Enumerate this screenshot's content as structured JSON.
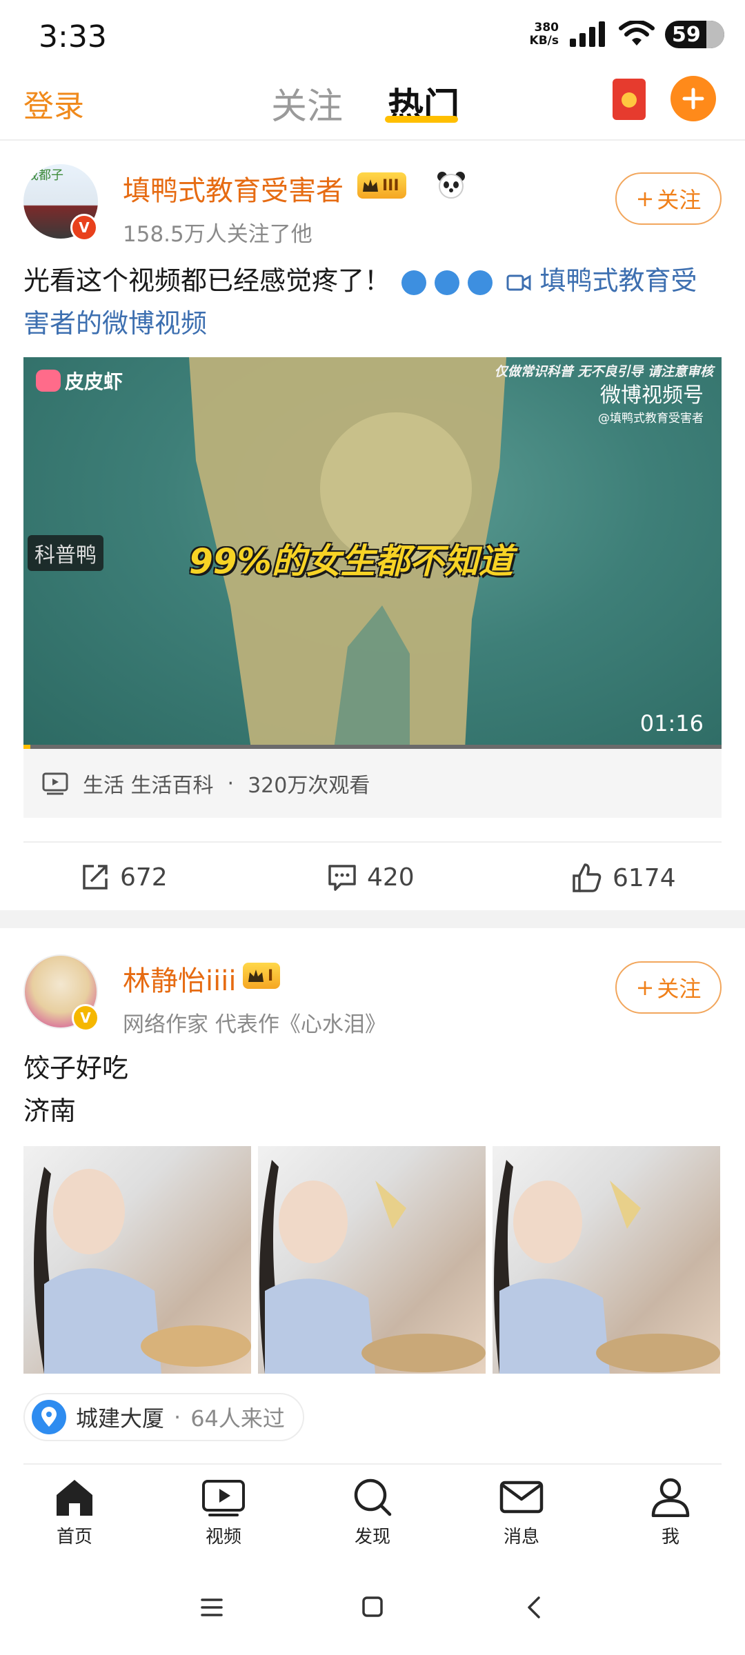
{
  "status_bar": {
    "time": "3:33",
    "net_speed_value": "380",
    "net_speed_unit": "KB/s",
    "battery": "59"
  },
  "top_nav": {
    "login": "登录",
    "tabs": [
      {
        "label": "关注"
      },
      {
        "label": "热门"
      }
    ],
    "active_tab": "热门"
  },
  "colors": {
    "accent": "#f08a1c",
    "link": "#3d6fb0",
    "username": "#e66b12",
    "tab_indicator": "#ffbf00"
  },
  "post1": {
    "avatar_tag": "成都子",
    "username": "填鸭式教育受害者",
    "level_badge": "III",
    "followers": "158.5万人关注了他",
    "follow_label": "关注",
    "text": "光看这个视频都已经感觉疼了！",
    "link_text": "填鸭式教育受害者的微博视频",
    "video": {
      "logo_text": "皮皮虾",
      "top_notice": "仅做常识科普  无不良引导  请注意审核",
      "channel": "微博视频号",
      "channel_handle": "@填鸭式教育受害者",
      "side_tag": "科普鸭",
      "caption": "99%的女生都不知道",
      "duration": "01:16"
    },
    "video_info": {
      "category": "生活",
      "subcategory": "生活百科",
      "views": "320万次观看"
    },
    "actions": {
      "reposts": "672",
      "comments": "420",
      "likes": "6174"
    }
  },
  "post2": {
    "username": "林静怡iiii",
    "level_badge": "I",
    "bio": "网络作家 代表作《心水泪》",
    "follow_label": "关注",
    "text_line1": "饺子好吃",
    "text_line2": "济南",
    "images_count": 3,
    "location": "城建大厦",
    "visits": "64人来过"
  },
  "tabbar": {
    "items": [
      {
        "label": "首页"
      },
      {
        "label": "视频"
      },
      {
        "label": "发现"
      },
      {
        "label": "消息"
      },
      {
        "label": "我"
      }
    ]
  }
}
